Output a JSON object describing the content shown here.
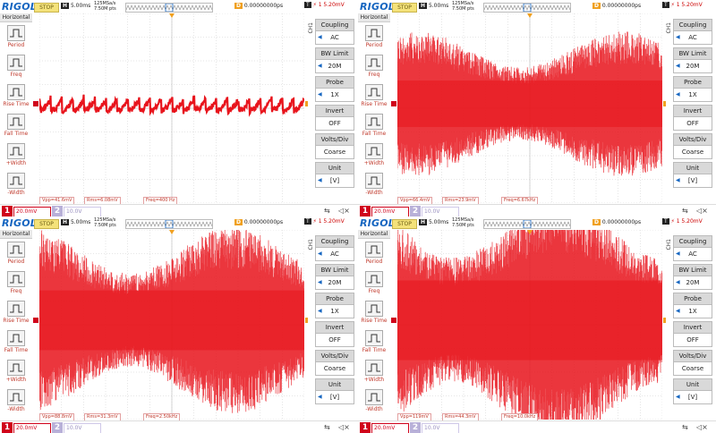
{
  "colors": {
    "waveform": "#e8141c",
    "grid": "#cccccc",
    "accent": "#1565c0",
    "trigger": "#f0a020"
  },
  "panels": [
    {
      "logo": "RIGOL",
      "mode": "STOP",
      "timebase": "5.00ms",
      "sample_rate": "125MSa/s",
      "memory": "7.50M pts",
      "delay": "0.00000000ps",
      "trigger_level": "5.20mV",
      "left_menu": {
        "title": "Horizontal",
        "items": [
          "Period",
          "Freq",
          "Rise Time",
          "Fall Time",
          "+Width",
          "-Width"
        ]
      },
      "right_menu": {
        "channel": "CH1",
        "items": [
          {
            "title": "Coupling",
            "value": "AC"
          },
          {
            "title": "BW Limit",
            "value": "20M"
          },
          {
            "title": "Probe",
            "value": "1X"
          },
          {
            "title": "Invert",
            "value": "OFF"
          },
          {
            "title": "Volts/Div",
            "value": "Coarse"
          },
          {
            "title": "Unit",
            "value": "[V]"
          }
        ]
      },
      "measurements": [
        "Vpp=41.6mV",
        "Rms=6.08mV",
        "Freq=400 Hz"
      ],
      "ch1_label": "1",
      "ch1_scale": "20.0mV",
      "ch2_label": "2",
      "ch2_scale": "10.0V",
      "waveform_type": "pulse",
      "noise_amplitude": 0.05
    },
    {
      "logo": "RIGOL",
      "mode": "STOP",
      "timebase": "5.00ms",
      "sample_rate": "125MSa/s",
      "memory": "7.50M pts",
      "delay": "0.00000000ps",
      "trigger_level": "5.20mV",
      "left_menu": {
        "title": "Horizontal",
        "items": [
          "Period",
          "Freq",
          "Rise Time",
          "Fall Time",
          "+Width",
          "-Width"
        ]
      },
      "right_menu": {
        "channel": "CH1",
        "items": [
          {
            "title": "Coupling",
            "value": "AC"
          },
          {
            "title": "BW Limit",
            "value": "20M"
          },
          {
            "title": "Probe",
            "value": "1X"
          },
          {
            "title": "Invert",
            "value": "OFF"
          },
          {
            "title": "Volts/Div",
            "value": "Coarse"
          },
          {
            "title": "Unit",
            "value": "[V]"
          }
        ]
      },
      "measurements": [
        "Vpp=66.4mV",
        "Rms=23.9mV",
        "Freq=6.67kHz"
      ],
      "ch1_label": "1",
      "ch1_scale": "20.0mV",
      "ch2_label": "2",
      "ch2_scale": "10.0V",
      "waveform_type": "noise",
      "noise_amplitude": 0.35
    },
    {
      "logo": "RIGOL",
      "mode": "STOP",
      "timebase": "5.00ms",
      "sample_rate": "125MSa/s",
      "memory": "7.50M pts",
      "delay": "0.00000000ps",
      "trigger_level": "5.20mV",
      "left_menu": {
        "title": "Horizontal",
        "items": [
          "Period",
          "Freq",
          "Rise Time",
          "Fall Time",
          "+Width",
          "-Width"
        ]
      },
      "right_menu": {
        "channel": "CH1",
        "items": [
          {
            "title": "Coupling",
            "value": "AC"
          },
          {
            "title": "BW Limit",
            "value": "20M"
          },
          {
            "title": "Probe",
            "value": "1X"
          },
          {
            "title": "Invert",
            "value": "OFF"
          },
          {
            "title": "Volts/Div",
            "value": "Coarse"
          },
          {
            "title": "Unit",
            "value": "[V]"
          }
        ]
      },
      "measurements": [
        "Vpp=88.8mV",
        "Rms=31.3mV",
        "Freq=2.50kHz"
      ],
      "ch1_label": "1",
      "ch1_scale": "20.0mV",
      "ch2_label": "2",
      "ch2_scale": "10.0V",
      "waveform_type": "noise",
      "noise_amplitude": 0.45
    },
    {
      "logo": "RIGOL",
      "mode": "STOP",
      "timebase": "5.00ms",
      "sample_rate": "125MSa/s",
      "memory": "7.50M pts",
      "delay": "0.00000000ps",
      "trigger_level": "5.20mV",
      "left_menu": {
        "title": "Horizontal",
        "items": [
          "Period",
          "Freq",
          "Rise Time",
          "Fall Time",
          "+Width",
          "-Width"
        ]
      },
      "right_menu": {
        "channel": "CH1",
        "items": [
          {
            "title": "Coupling",
            "value": "AC"
          },
          {
            "title": "BW Limit",
            "value": "20M"
          },
          {
            "title": "Probe",
            "value": "1X"
          },
          {
            "title": "Invert",
            "value": "OFF"
          },
          {
            "title": "Volts/Div",
            "value": "Coarse"
          },
          {
            "title": "Unit",
            "value": "[V]"
          }
        ]
      },
      "measurements": [
        "Vpp=119mV",
        "Rms=44.3mV",
        "Freq=10.0kHz"
      ],
      "ch1_label": "1",
      "ch1_scale": "20.0mV",
      "ch2_label": "2",
      "ch2_scale": "10.0V",
      "waveform_type": "noise",
      "noise_amplitude": 0.6
    }
  ]
}
